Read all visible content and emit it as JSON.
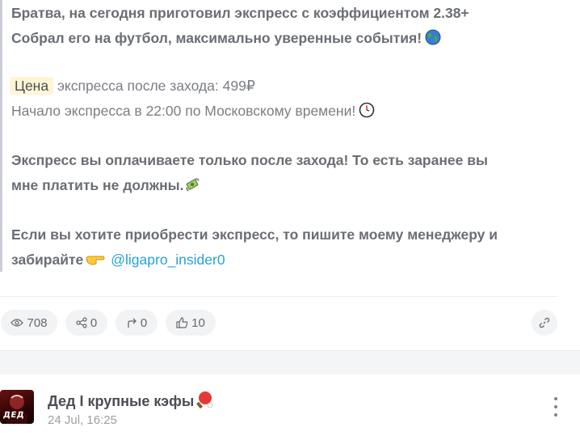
{
  "post": {
    "line1": "Братва, на сегодня приготовил экспресс с коэффициентом 2.38+",
    "line2": "Собрал его на футбол, максимально уверенные события!",
    "price_label": "Цена",
    "price_rest": " экспресса после захода: 499₽",
    "start_line": "Начало экспресса в 22:00 по Московскому времени!",
    "pay_line1": "Экспресс вы оплачиваете только после захода! То есть заранее вы",
    "pay_line2": "мне платить не должны.",
    "buy_line1": "Если вы хотите приобрести экспресс, то пишите моему менеджеру и",
    "buy_line2": "забирайте",
    "manager_link": "@ligapro_insider0",
    "icons": [
      "globe-icon",
      "clock-icon",
      "money-wings-icon",
      "pointing-hand-icon"
    ]
  },
  "stats": {
    "views": "708",
    "shares": "0",
    "forwards": "0",
    "likes": "10"
  },
  "next_post": {
    "channel_name": "Дед I крупные кэфы",
    "channel_emoji": "ping-pong-icon",
    "date": "24 Jul, 16:25",
    "avatar_text": "ДЕД"
  },
  "colors": {
    "accent_link": "#2aa0d8",
    "highlight_bg": "#fff5d6",
    "pill_bg": "#f1f3f5"
  }
}
